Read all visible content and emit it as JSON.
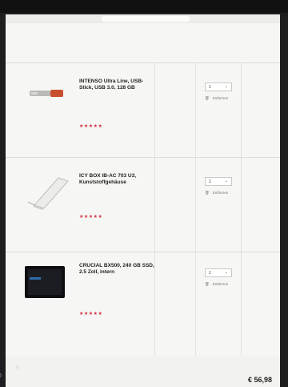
{
  "status_bar": {
    "left": "",
    "center": "",
    "right": ""
  },
  "browser": {
    "url": "",
    "tabs": [
      "",
      ""
    ]
  },
  "breadcrumb": "",
  "notice": "",
  "items": [
    {
      "name": "INTENSO Ultra Line, USB-Stick, USB 3.0, 128 GB",
      "meta": [],
      "stars": "★★★★★",
      "ratings": "",
      "art_nr": "",
      "unit_price": "",
      "qty": "1",
      "remove_label": "Entfernen",
      "total": ""
    },
    {
      "name": "ICY BOX IB-AC 703 U3, Kunststoffgehäuse",
      "meta": [],
      "stars": "★★★★★",
      "ratings": "",
      "art_nr": "",
      "unit_price": "",
      "qty": "1",
      "remove_label": "Entfernen",
      "total": ""
    },
    {
      "name": "CRUCIAL BX500, 240 GB SSD, 2.5 Zoll, intern",
      "meta": [],
      "stars": "★★★★★",
      "ratings": "",
      "art_nr": "",
      "unit_price": "",
      "qty": "1",
      "remove_label": "Entfernen",
      "total": ""
    }
  ],
  "summary": {
    "rows": [
      {
        "label": "",
        "value": ""
      },
      {
        "label": "",
        "value": ""
      },
      {
        "label": "",
        "value": ""
      }
    ],
    "grand_label": "",
    "grand_value": "€ 56,98"
  },
  "corner": ")"
}
